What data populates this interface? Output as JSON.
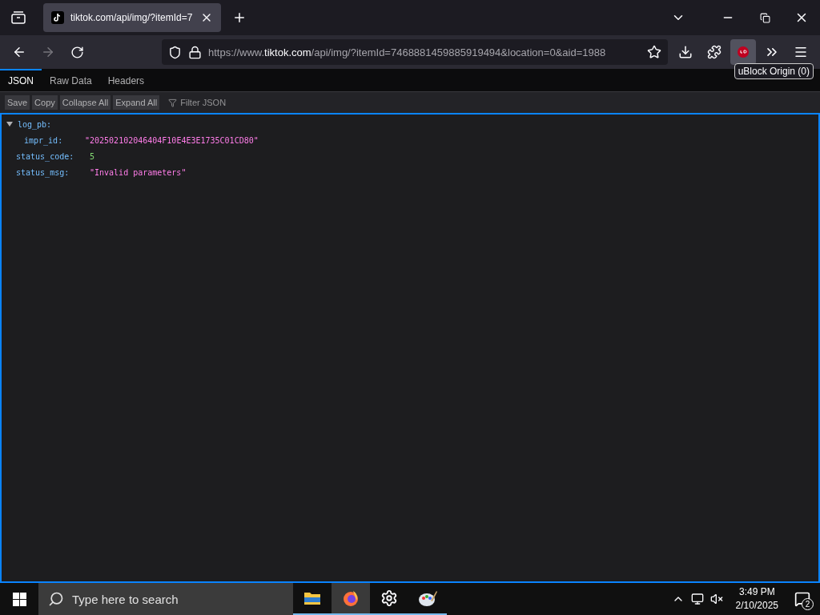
{
  "browser": {
    "tab": {
      "title": "tiktok.com/api/img/?itemId=7",
      "selected": true
    },
    "url": {
      "prefix": "https://www.",
      "host": "tiktok.com",
      "rest": "/api/img/?itemId=7468881459885919494&location=0&aid=1988"
    },
    "tooltip": "uBlock Origin (0)"
  },
  "viewer": {
    "tabs": [
      {
        "label": "JSON",
        "selected": true
      },
      {
        "label": "Raw Data",
        "selected": false
      },
      {
        "label": "Headers",
        "selected": false
      }
    ],
    "buttons": [
      "Save",
      "Copy",
      "Collapse All",
      "Expand All"
    ],
    "filter": {
      "placeholder": "Filter JSON"
    },
    "tree": [
      {
        "key": "log_pb:",
        "expanded": true,
        "children": [
          {
            "key": "impr_id:",
            "value": "\"202502102046404F10E4E3E1735C01CD80\"",
            "kind": "string"
          }
        ]
      },
      {
        "key": "status_code:",
        "value": "5",
        "kind": "number"
      },
      {
        "key": "status_msg:",
        "value": "\"Invalid parameters\"",
        "kind": "string"
      }
    ]
  },
  "taskbar": {
    "search": {
      "placeholder": "Type here to search"
    },
    "apps": [
      {
        "kind": "folder",
        "selected": false
      },
      {
        "kind": "firefox",
        "selected": true
      },
      {
        "kind": "gear",
        "selected": false
      },
      {
        "kind": "paint",
        "selected": false
      }
    ],
    "time": "3:49 PM",
    "date": "2/10/2025",
    "notifications": "2"
  }
}
